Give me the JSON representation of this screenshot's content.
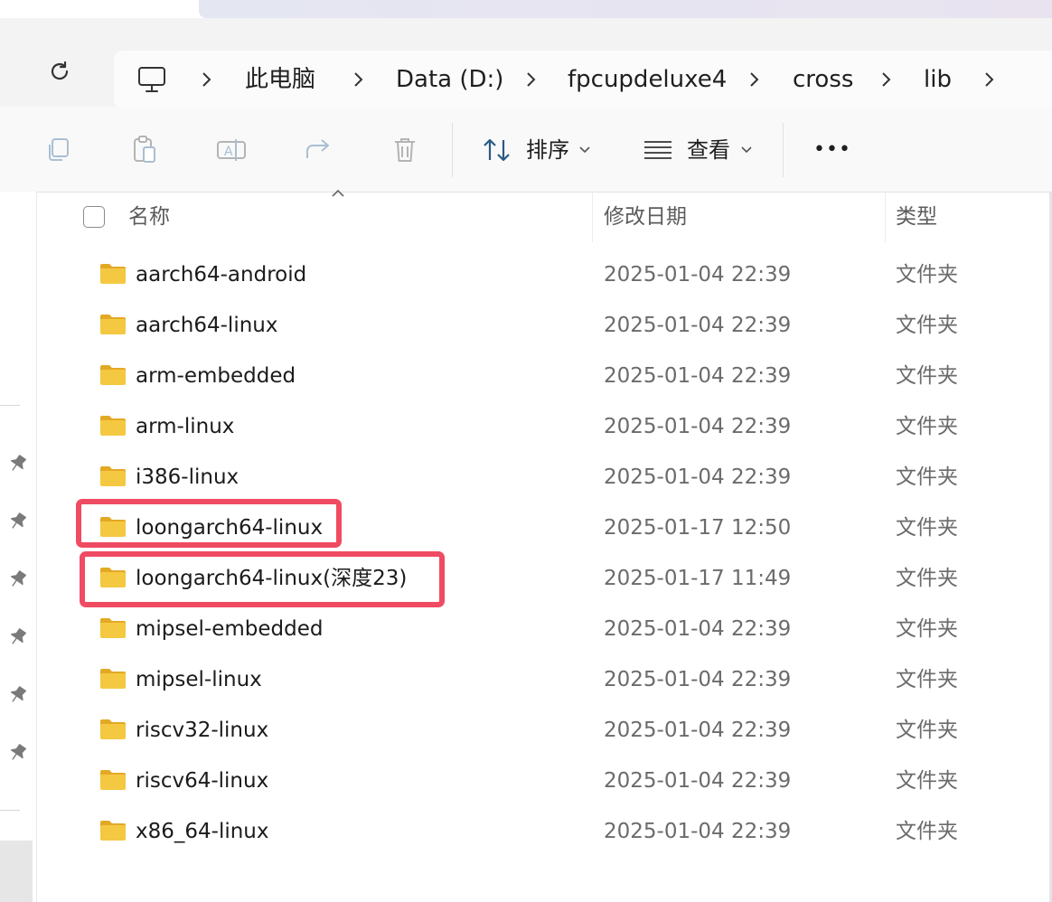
{
  "breadcrumb": {
    "items": [
      "此电脑",
      "Data (D:)",
      "fpcupdeluxe4",
      "cross",
      "lib"
    ]
  },
  "commandbar": {
    "sort_label": "排序",
    "view_label": "查看",
    "more_label": "•••"
  },
  "columns": {
    "name": "名称",
    "date": "修改日期",
    "type": "类型"
  },
  "rows": [
    {
      "name": "aarch64-android",
      "date": "2025-01-04 22:39",
      "type": "文件夹"
    },
    {
      "name": "aarch64-linux",
      "date": "2025-01-04 22:39",
      "type": "文件夹"
    },
    {
      "name": "arm-embedded",
      "date": "2025-01-04 22:39",
      "type": "文件夹"
    },
    {
      "name": "arm-linux",
      "date": "2025-01-04 22:39",
      "type": "文件夹"
    },
    {
      "name": "i386-linux",
      "date": "2025-01-04 22:39",
      "type": "文件夹"
    },
    {
      "name": "loongarch64-linux",
      "date": "2025-01-17 12:50",
      "type": "文件夹"
    },
    {
      "name": "loongarch64-linux(深度23)",
      "date": "2025-01-17 11:49",
      "type": "文件夹"
    },
    {
      "name": "mipsel-embedded",
      "date": "2025-01-04 22:39",
      "type": "文件夹"
    },
    {
      "name": "mipsel-linux",
      "date": "2025-01-04 22:39",
      "type": "文件夹"
    },
    {
      "name": "riscv32-linux",
      "date": "2025-01-04 22:39",
      "type": "文件夹"
    },
    {
      "name": "riscv64-linux",
      "date": "2025-01-04 22:39",
      "type": "文件夹"
    },
    {
      "name": "x86_64-linux",
      "date": "2025-01-04 22:39",
      "type": "文件夹"
    }
  ],
  "colors": {
    "highlight": "#ef4b62",
    "folder_body": "#f5c842",
    "folder_tab": "#e3a924"
  },
  "icons": [
    "refresh-icon",
    "this-pc-icon",
    "chevron-right-icon",
    "copy-icon",
    "paste-icon",
    "rename-icon",
    "share-icon",
    "delete-icon",
    "sort-icon",
    "view-icon",
    "pin-icon",
    "folder-icon"
  ]
}
